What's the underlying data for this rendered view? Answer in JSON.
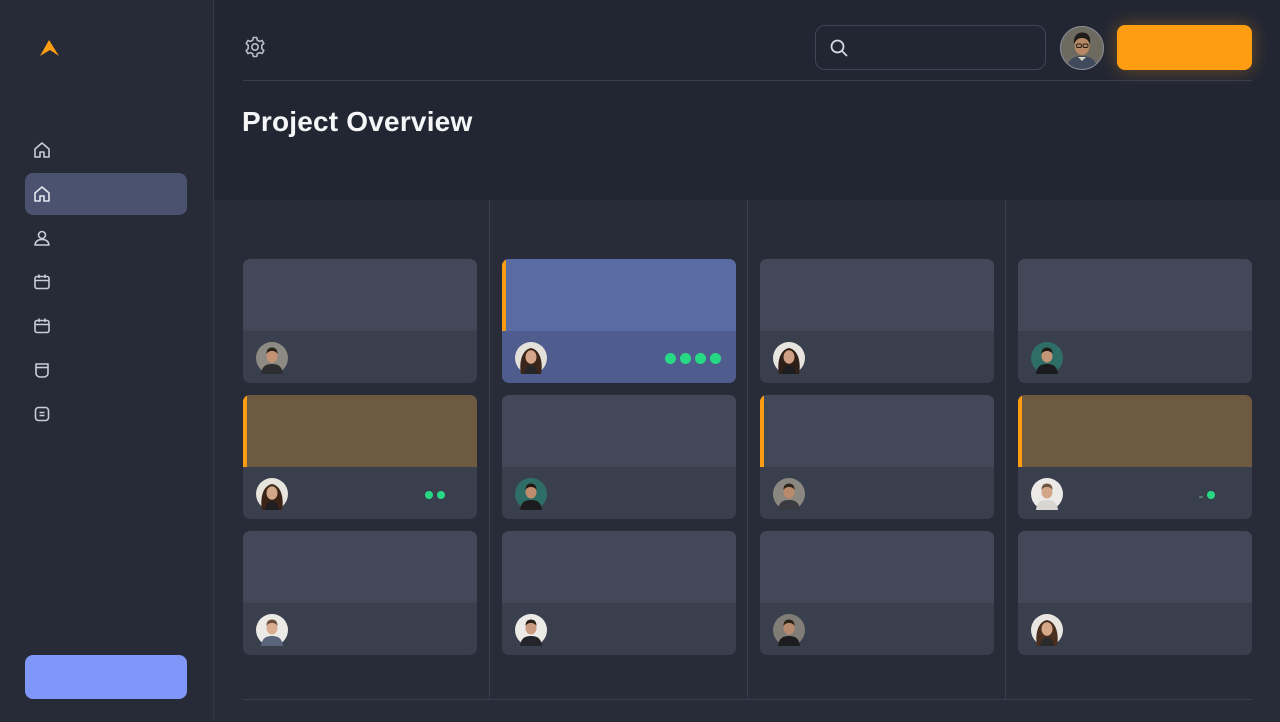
{
  "page": {
    "title": "Project Overview"
  },
  "topbar": {
    "search_placeholder": ""
  },
  "colors": {
    "brand": "#ff9d12",
    "active_nav": "#4b5270",
    "sidebar_cta": "#7f97f8",
    "status_green": "#27d985",
    "card_blue": "#5a6aa2",
    "card_amber": "#6e5a40"
  },
  "sidebar": {
    "items": [
      {
        "icon": "home-icon",
        "active": false
      },
      {
        "icon": "home-icon",
        "active": true
      },
      {
        "icon": "user-icon",
        "active": false
      },
      {
        "icon": "calendar-icon",
        "active": false
      },
      {
        "icon": "calendar-icon",
        "active": false
      },
      {
        "icon": "inbox-icon",
        "active": false
      },
      {
        "icon": "document-icon",
        "active": false
      }
    ]
  },
  "board": {
    "columns": [
      {
        "cards": [
          {
            "highlight": "none",
            "dots": 0
          },
          {
            "highlight": "amber",
            "dots": 2
          },
          {
            "highlight": "none",
            "dots": 0
          }
        ]
      },
      {
        "cards": [
          {
            "highlight": "blue",
            "dots": 4
          },
          {
            "highlight": "none",
            "dots": 0
          },
          {
            "highlight": "none",
            "dots": 0
          }
        ]
      },
      {
        "cards": [
          {
            "highlight": "none",
            "dots": 0
          },
          {
            "highlight": "accent",
            "dots": 0
          },
          {
            "highlight": "none",
            "dots": 0
          }
        ]
      },
      {
        "cards": [
          {
            "highlight": "none",
            "dots": 0
          },
          {
            "highlight": "amber",
            "dots": 2
          },
          {
            "highlight": "none",
            "dots": 0
          }
        ]
      }
    ]
  }
}
